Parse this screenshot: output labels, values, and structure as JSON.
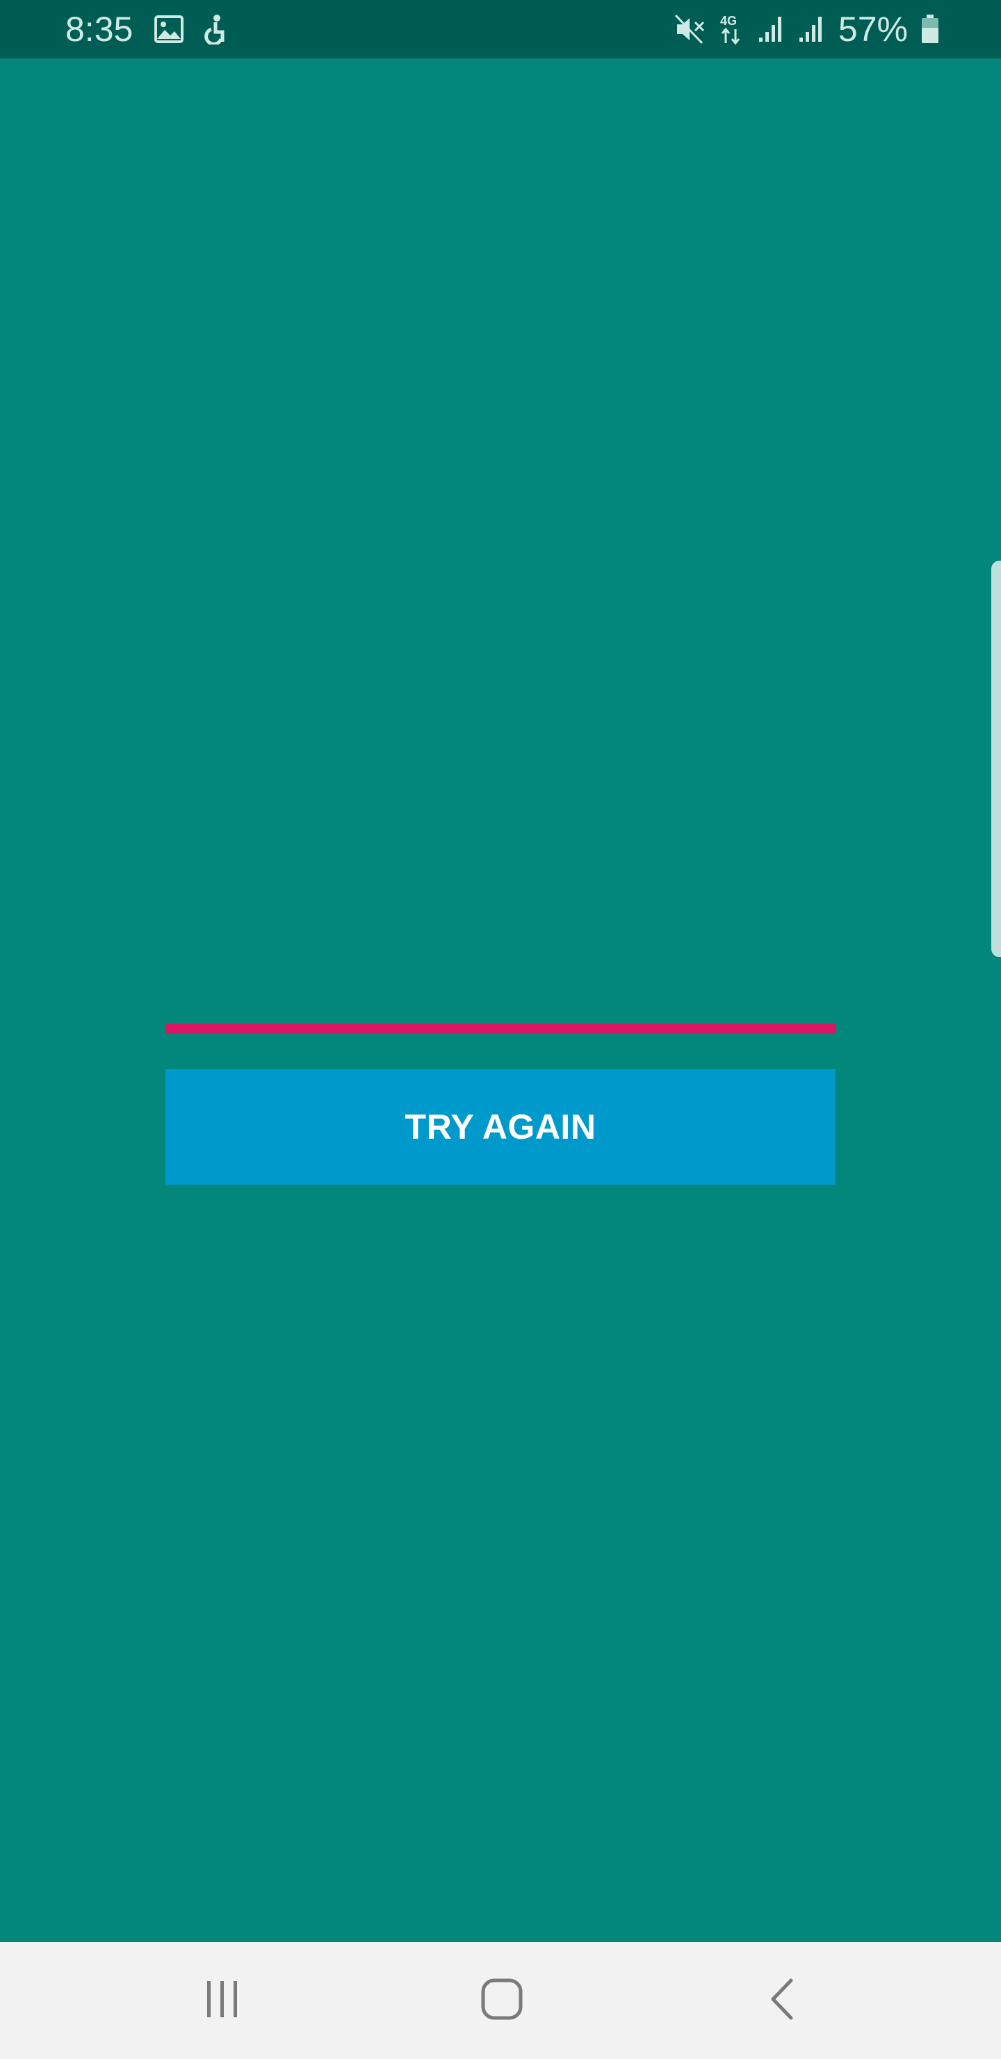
{
  "status_bar": {
    "time": "8:35",
    "battery_percent": "57%",
    "network_label": "4G",
    "icons": [
      "gallery-icon",
      "accessibility-icon",
      "mute-icon",
      "4g-data-icon",
      "signal-icon",
      "signal-icon",
      "battery-icon"
    ]
  },
  "main": {
    "error_indicator_color": "#dd1663",
    "try_again_label": "TRY AGAIN",
    "button_color": "#0099cc",
    "background_color": "#02877a"
  },
  "nav_bar": {
    "buttons": [
      "recents-icon",
      "home-icon",
      "back-icon"
    ]
  }
}
